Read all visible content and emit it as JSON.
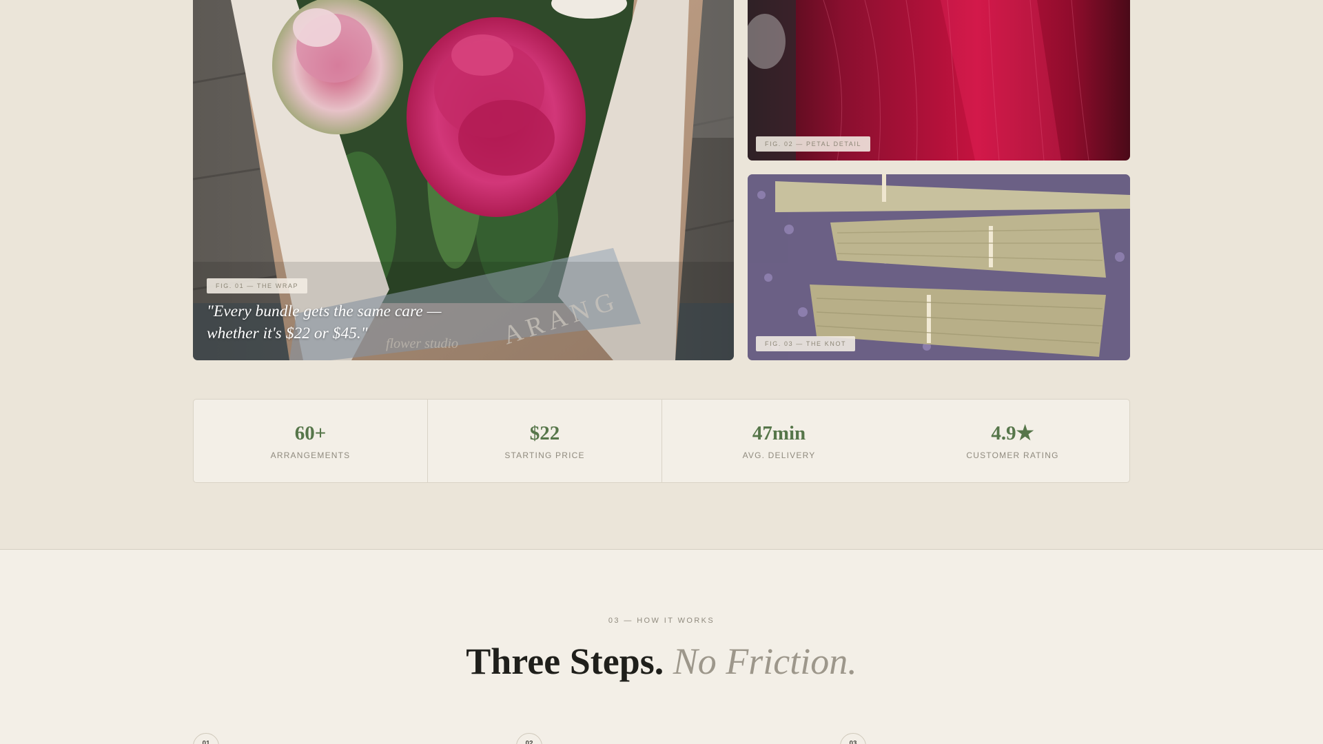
{
  "gallery": {
    "feature": {
      "fig_label": "FIG. 01 — THE WRAP",
      "quote": "\"Every bundle gets the same care — whether it's $22 or $45.\"",
      "wrap_print": "A R A N G",
      "wrap_script": "flower studio"
    },
    "petal": {
      "fig_label": "FIG. 02 — PETAL DETAIL"
    },
    "knot": {
      "fig_label": "FIG. 03 — THE KNOT"
    }
  },
  "stats": [
    {
      "value": "60+",
      "label": "ARRANGEMENTS"
    },
    {
      "value": "$22",
      "label": "STARTING PRICE"
    },
    {
      "value": "47min",
      "label": "AVG. DELIVERY"
    },
    {
      "value": "4.9★",
      "label": "CUSTOMER RATING"
    }
  ],
  "how_it_works": {
    "eyebrow": "03 — HOW IT WORKS",
    "title_strong": "Three Steps.",
    "title_soft": "No Friction.",
    "steps": [
      {
        "number": "01"
      },
      {
        "number": "02"
      },
      {
        "number": "03"
      }
    ]
  },
  "colors": {
    "page_background": "#ebe5d9",
    "panel_background": "#f3efe7",
    "accent_green": "#56764a",
    "muted_text": "#8f8a7e",
    "heading": "#1f1f1b"
  }
}
